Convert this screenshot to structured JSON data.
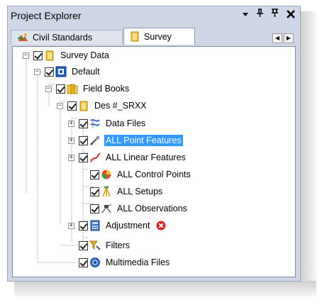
{
  "panel": {
    "title": "Project Explorer",
    "controls": {
      "dropdown": "▾",
      "pin": "⊕",
      "float": "⊥",
      "close": "✕"
    }
  },
  "tabs": [
    {
      "label": "Civil Standards",
      "icon": "civil-standards-icon",
      "active": false
    },
    {
      "label": "Survey",
      "icon": "survey-folder-icon",
      "active": true
    }
  ],
  "tab_nav": {
    "prev": "◀",
    "next": "▶"
  },
  "tree": {
    "items": [
      {
        "label": "Survey Data",
        "icon": "folder-icon",
        "checked": true,
        "expander": "−"
      },
      {
        "label": "Default",
        "icon": "database-icon",
        "checked": true,
        "expander": "−"
      },
      {
        "label": "Field Books",
        "icon": "books-icon",
        "checked": true,
        "expander": "−"
      },
      {
        "label": "Des #_SRXX",
        "icon": "folder-icon",
        "checked": true,
        "expander": "−"
      },
      {
        "label": "Data Files",
        "icon": "data-files-icon",
        "checked": true,
        "expander": "+"
      },
      {
        "label": "ALL Point Features",
        "icon": "point-features-icon",
        "checked": true,
        "expander": "+",
        "selected": true
      },
      {
        "label": "ALL Linear Features",
        "icon": "linear-features-icon",
        "checked": true,
        "expander": "+"
      },
      {
        "label": "ALL Control Points",
        "icon": "control-points-icon",
        "checked": true
      },
      {
        "label": "ALL Setups",
        "icon": "setups-icon",
        "checked": true
      },
      {
        "label": "ALL Observations",
        "icon": "observations-icon",
        "checked": true
      },
      {
        "label": "Adjustment",
        "icon": "calculator-icon",
        "checked": true,
        "expander": "+",
        "status": "error-icon"
      },
      {
        "label": "Filters",
        "icon": "filter-icon",
        "checked": true
      },
      {
        "label": "Multimedia Files",
        "icon": "multimedia-icon",
        "checked": true
      }
    ]
  },
  "colors": {
    "selection": "#3399ff",
    "panel_bg": "#cfd6e5",
    "error": "#d6262b"
  }
}
